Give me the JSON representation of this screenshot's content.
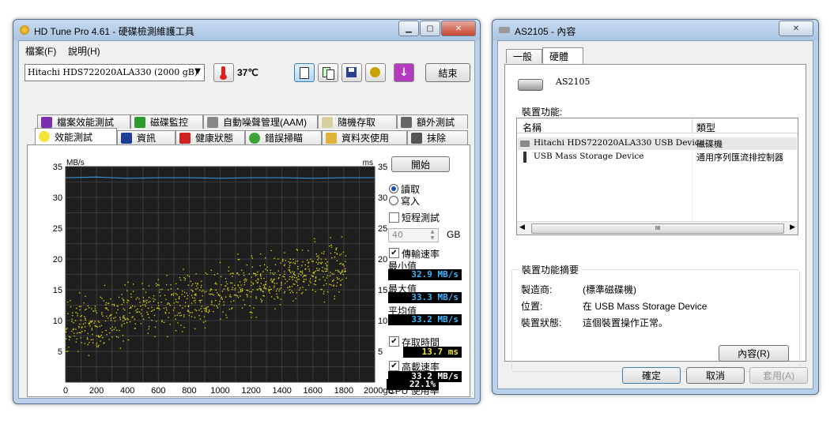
{
  "hdtune": {
    "title": "HD Tune Pro 4.61 - 硬碟檢測維護工具",
    "menu": [
      "檔案(F)",
      "說明(H)"
    ],
    "drive": "Hitachi HDS722020ALA330  (2000 gB)",
    "temperature": "37℃",
    "exit_label": "結束",
    "tabs_row1": [
      "檔案效能測試",
      "磁碟監控",
      "自動噪聲管理(AAM)",
      "隨機存取",
      "額外測試"
    ],
    "tabs_row2": [
      "效能測試",
      "資訊",
      "健康狀態",
      "錯誤掃瞄",
      "資料夾使用",
      "抹除"
    ],
    "start_label": "開始",
    "read_label": "讀取",
    "write_label": "寫入",
    "short_test_label": "短程測試",
    "short_test_value": "40",
    "short_test_unit": "GB",
    "transfer_rate_label": "傳輸速率",
    "min_label": "最小值",
    "min_value": "32.9 MB/s",
    "max_label": "最大值",
    "max_value": "33.3 MB/s",
    "avg_label": "平均值",
    "avg_value": "33.2 MB/s",
    "access_time_label": "存取時間",
    "access_time_value": "13.7 ms",
    "burst_rate_label": "高載速率",
    "burst_rate_value": "33.2 MB/s",
    "cpu_label": "CPU 使用率",
    "cpu_value": "22.1%"
  },
  "chart_data": {
    "type": "scatter",
    "ylabel_left": "MB/s",
    "ylabel_right": "ms",
    "x_ticks": [
      "0",
      "200",
      "400",
      "600",
      "800",
      "1000",
      "1200",
      "1400",
      "1600",
      "1800",
      "2000gB"
    ],
    "y_ticks": [
      "35",
      "30",
      "25",
      "20",
      "15",
      "10",
      "5"
    ],
    "xlim": [
      0,
      2000
    ],
    "ylim": [
      0,
      35
    ],
    "grid": true,
    "series": [
      {
        "type": "line",
        "color": "#3a8fd0",
        "x": [
          0,
          200,
          400,
          600,
          800,
          1000,
          1200,
          1400,
          1600,
          1800,
          2000
        ],
        "y": [
          33.2,
          33.3,
          33.1,
          33.2,
          33.2,
          33.1,
          33.2,
          33.2,
          33.1,
          33.2,
          33.2
        ]
      },
      {
        "type": "scatter",
        "color": "#e8e800",
        "trend_start": 9,
        "trend_end": 19,
        "spread": 5
      }
    ]
  },
  "props": {
    "title": "AS2105 - 內容",
    "tabs": [
      "一般",
      "硬體"
    ],
    "device_name": "AS2105",
    "functions_label": "裝置功能:",
    "columns": [
      "名稱",
      "類型"
    ],
    "rows": [
      {
        "name": "Hitachi HDS722020ALA330 USB Device",
        "type": "磁碟機"
      },
      {
        "name": "USB Mass Storage Device",
        "type": "通用序列匯流排控制器"
      }
    ],
    "scrollbar_glyph": "III",
    "summary_label": "裝置功能摘要",
    "manufacturer_label": "製造商:",
    "manufacturer_value": "(標準磁碟機)",
    "location_label": "位置:",
    "location_value": "在 USB Mass Storage Device",
    "status_label": "裝置狀態:",
    "status_value": "這個裝置操作正常。",
    "properties_button": "內容(R)",
    "ok": "確定",
    "cancel": "取消",
    "apply": "套用(A)"
  }
}
